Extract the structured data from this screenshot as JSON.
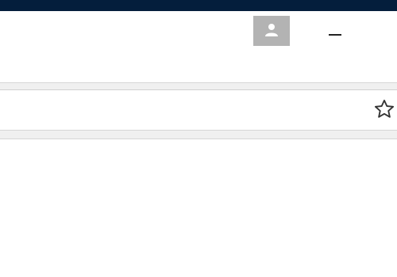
{
  "window": {
    "accent_color": "#041e3c",
    "profile_button_icon": "person-icon",
    "minimize_icon": "minimize-icon"
  },
  "toolbar": {
    "bookmark_icon": "star-outline-icon"
  }
}
